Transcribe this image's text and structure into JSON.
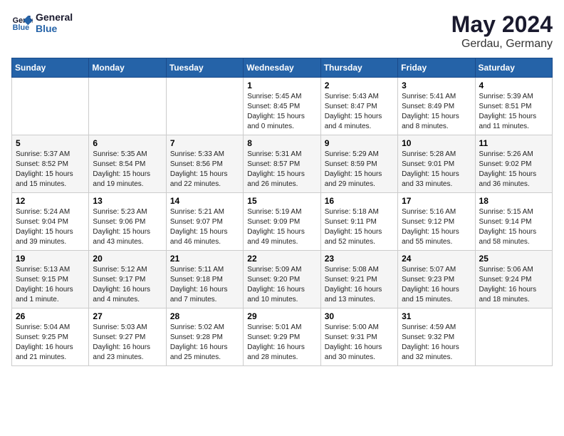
{
  "header": {
    "logo_line1": "General",
    "logo_line2": "Blue",
    "title": "May 2024",
    "subtitle": "Gerdau, Germany"
  },
  "weekdays": [
    "Sunday",
    "Monday",
    "Tuesday",
    "Wednesday",
    "Thursday",
    "Friday",
    "Saturday"
  ],
  "weeks": [
    [
      {
        "day": "",
        "info": ""
      },
      {
        "day": "",
        "info": ""
      },
      {
        "day": "",
        "info": ""
      },
      {
        "day": "1",
        "info": "Sunrise: 5:45 AM\nSunset: 8:45 PM\nDaylight: 15 hours\nand 0 minutes."
      },
      {
        "day": "2",
        "info": "Sunrise: 5:43 AM\nSunset: 8:47 PM\nDaylight: 15 hours\nand 4 minutes."
      },
      {
        "day": "3",
        "info": "Sunrise: 5:41 AM\nSunset: 8:49 PM\nDaylight: 15 hours\nand 8 minutes."
      },
      {
        "day": "4",
        "info": "Sunrise: 5:39 AM\nSunset: 8:51 PM\nDaylight: 15 hours\nand 11 minutes."
      }
    ],
    [
      {
        "day": "5",
        "info": "Sunrise: 5:37 AM\nSunset: 8:52 PM\nDaylight: 15 hours\nand 15 minutes."
      },
      {
        "day": "6",
        "info": "Sunrise: 5:35 AM\nSunset: 8:54 PM\nDaylight: 15 hours\nand 19 minutes."
      },
      {
        "day": "7",
        "info": "Sunrise: 5:33 AM\nSunset: 8:56 PM\nDaylight: 15 hours\nand 22 minutes."
      },
      {
        "day": "8",
        "info": "Sunrise: 5:31 AM\nSunset: 8:57 PM\nDaylight: 15 hours\nand 26 minutes."
      },
      {
        "day": "9",
        "info": "Sunrise: 5:29 AM\nSunset: 8:59 PM\nDaylight: 15 hours\nand 29 minutes."
      },
      {
        "day": "10",
        "info": "Sunrise: 5:28 AM\nSunset: 9:01 PM\nDaylight: 15 hours\nand 33 minutes."
      },
      {
        "day": "11",
        "info": "Sunrise: 5:26 AM\nSunset: 9:02 PM\nDaylight: 15 hours\nand 36 minutes."
      }
    ],
    [
      {
        "day": "12",
        "info": "Sunrise: 5:24 AM\nSunset: 9:04 PM\nDaylight: 15 hours\nand 39 minutes."
      },
      {
        "day": "13",
        "info": "Sunrise: 5:23 AM\nSunset: 9:06 PM\nDaylight: 15 hours\nand 43 minutes."
      },
      {
        "day": "14",
        "info": "Sunrise: 5:21 AM\nSunset: 9:07 PM\nDaylight: 15 hours\nand 46 minutes."
      },
      {
        "day": "15",
        "info": "Sunrise: 5:19 AM\nSunset: 9:09 PM\nDaylight: 15 hours\nand 49 minutes."
      },
      {
        "day": "16",
        "info": "Sunrise: 5:18 AM\nSunset: 9:11 PM\nDaylight: 15 hours\nand 52 minutes."
      },
      {
        "day": "17",
        "info": "Sunrise: 5:16 AM\nSunset: 9:12 PM\nDaylight: 15 hours\nand 55 minutes."
      },
      {
        "day": "18",
        "info": "Sunrise: 5:15 AM\nSunset: 9:14 PM\nDaylight: 15 hours\nand 58 minutes."
      }
    ],
    [
      {
        "day": "19",
        "info": "Sunrise: 5:13 AM\nSunset: 9:15 PM\nDaylight: 16 hours\nand 1 minute."
      },
      {
        "day": "20",
        "info": "Sunrise: 5:12 AM\nSunset: 9:17 PM\nDaylight: 16 hours\nand 4 minutes."
      },
      {
        "day": "21",
        "info": "Sunrise: 5:11 AM\nSunset: 9:18 PM\nDaylight: 16 hours\nand 7 minutes."
      },
      {
        "day": "22",
        "info": "Sunrise: 5:09 AM\nSunset: 9:20 PM\nDaylight: 16 hours\nand 10 minutes."
      },
      {
        "day": "23",
        "info": "Sunrise: 5:08 AM\nSunset: 9:21 PM\nDaylight: 16 hours\nand 13 minutes."
      },
      {
        "day": "24",
        "info": "Sunrise: 5:07 AM\nSunset: 9:23 PM\nDaylight: 16 hours\nand 15 minutes."
      },
      {
        "day": "25",
        "info": "Sunrise: 5:06 AM\nSunset: 9:24 PM\nDaylight: 16 hours\nand 18 minutes."
      }
    ],
    [
      {
        "day": "26",
        "info": "Sunrise: 5:04 AM\nSunset: 9:25 PM\nDaylight: 16 hours\nand 21 minutes."
      },
      {
        "day": "27",
        "info": "Sunrise: 5:03 AM\nSunset: 9:27 PM\nDaylight: 16 hours\nand 23 minutes."
      },
      {
        "day": "28",
        "info": "Sunrise: 5:02 AM\nSunset: 9:28 PM\nDaylight: 16 hours\nand 25 minutes."
      },
      {
        "day": "29",
        "info": "Sunrise: 5:01 AM\nSunset: 9:29 PM\nDaylight: 16 hours\nand 28 minutes."
      },
      {
        "day": "30",
        "info": "Sunrise: 5:00 AM\nSunset: 9:31 PM\nDaylight: 16 hours\nand 30 minutes."
      },
      {
        "day": "31",
        "info": "Sunrise: 4:59 AM\nSunset: 9:32 PM\nDaylight: 16 hours\nand 32 minutes."
      },
      {
        "day": "",
        "info": ""
      }
    ]
  ]
}
